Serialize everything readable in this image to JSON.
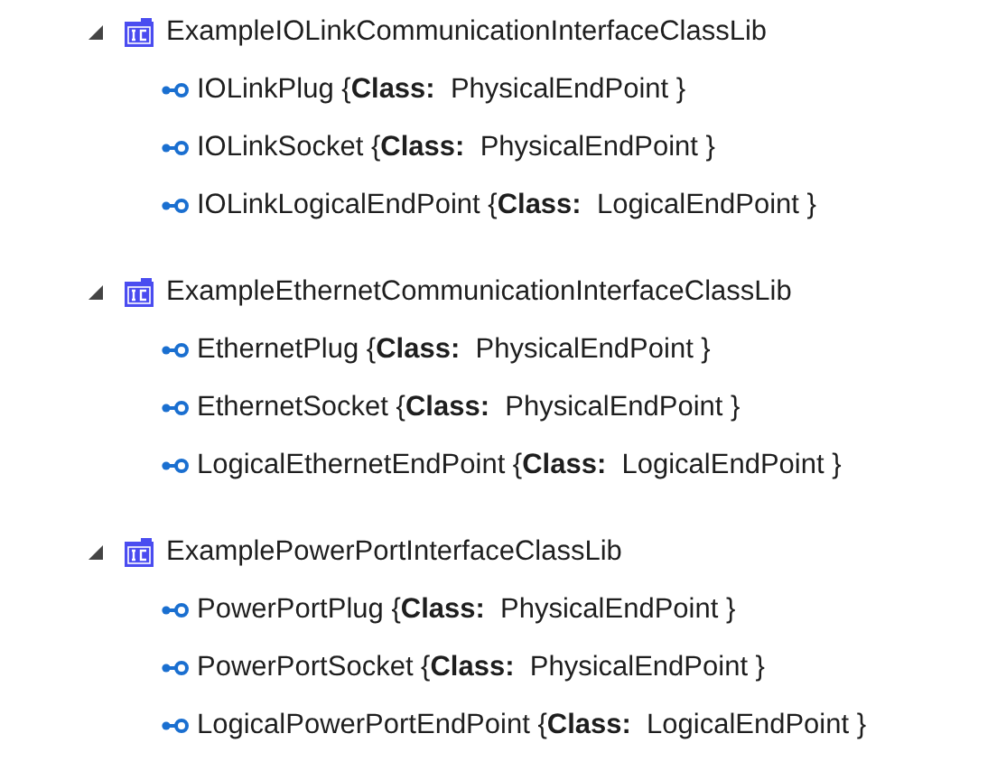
{
  "tree": [
    {
      "label": "ExampleIOLinkCommunicationInterfaceClassLib",
      "expanded": true,
      "children": [
        {
          "label": "IOLinkPlug {**Class:**  PhysicalEndPoint }"
        },
        {
          "label": "IOLinkSocket {**Class:**  PhysicalEndPoint }"
        },
        {
          "label": "IOLinkLogicalEndPoint {**Class:**  LogicalEndPoint }"
        }
      ]
    },
    {
      "label": "ExampleEthernetCommunicationInterfaceClassLib",
      "expanded": true,
      "children": [
        {
          "label": "EthernetPlug {**Class:**  PhysicalEndPoint }"
        },
        {
          "label": "EthernetSocket {**Class:**  PhysicalEndPoint }"
        },
        {
          "label": "LogicalEthernetEndPoint {**Class:**  LogicalEndPoint }"
        }
      ]
    },
    {
      "label": "ExamplePowerPortInterfaceClassLib",
      "expanded": true,
      "children": [
        {
          "label": "PowerPortPlug {**Class:**  PhysicalEndPoint }"
        },
        {
          "label": "PowerPortSocket {**Class:**  PhysicalEndPoint }"
        },
        {
          "label": "LogicalPowerPortEndPoint {**Class:**  LogicalEndPoint }"
        }
      ]
    }
  ]
}
